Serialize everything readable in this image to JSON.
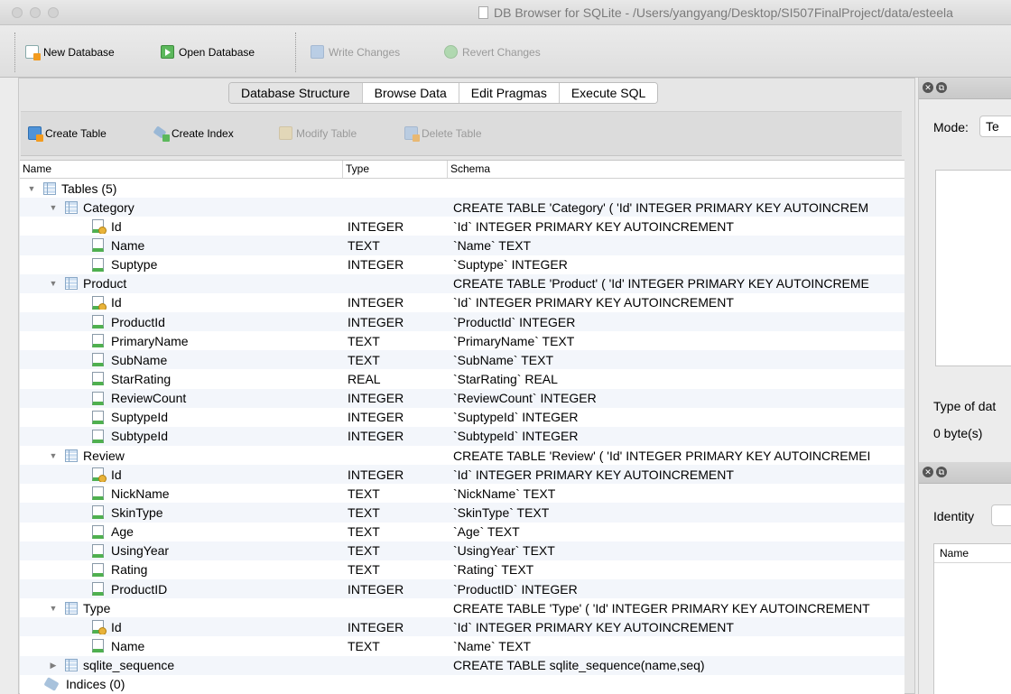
{
  "window": {
    "title": "DB Browser for SQLite - /Users/yangyang/Desktop/SI507FinalProject/data/esteela"
  },
  "toolbar": {
    "new_database": "New Database",
    "open_database": "Open Database",
    "write_changes": "Write Changes",
    "revert_changes": "Revert Changes"
  },
  "tabs": [
    "Database Structure",
    "Browse Data",
    "Edit Pragmas",
    "Execute SQL"
  ],
  "structure_toolbar": {
    "create_table": "Create Table",
    "create_index": "Create Index",
    "modify_table": "Modify Table",
    "delete_table": "Delete Table"
  },
  "tree": {
    "columns": [
      "Name",
      "Type",
      "Schema"
    ],
    "rows": [
      {
        "level": 0,
        "kind": "tables",
        "name": "Tables (5)",
        "type": "",
        "schema": "",
        "expanded": true
      },
      {
        "level": 1,
        "kind": "table",
        "name": "Category",
        "type": "",
        "schema": "CREATE TABLE 'Category' ( 'Id' INTEGER PRIMARY KEY AUTOINCREM",
        "expanded": true
      },
      {
        "level": 2,
        "kind": "key",
        "name": "Id",
        "type": "INTEGER",
        "schema": "`Id` INTEGER PRIMARY KEY AUTOINCREMENT"
      },
      {
        "level": 2,
        "kind": "field",
        "name": "Name",
        "type": "TEXT",
        "schema": "`Name` TEXT"
      },
      {
        "level": 2,
        "kind": "field",
        "name": "Suptype",
        "type": "INTEGER",
        "schema": "`Suptype` INTEGER"
      },
      {
        "level": 1,
        "kind": "table",
        "name": "Product",
        "type": "",
        "schema": "CREATE TABLE 'Product' ( 'Id' INTEGER PRIMARY KEY AUTOINCREME",
        "expanded": true
      },
      {
        "level": 2,
        "kind": "key",
        "name": "Id",
        "type": "INTEGER",
        "schema": "`Id` INTEGER PRIMARY KEY AUTOINCREMENT"
      },
      {
        "level": 2,
        "kind": "field",
        "name": "ProductId",
        "type": "INTEGER",
        "schema": "`ProductId` INTEGER"
      },
      {
        "level": 2,
        "kind": "field",
        "name": "PrimaryName",
        "type": "TEXT",
        "schema": "`PrimaryName` TEXT"
      },
      {
        "level": 2,
        "kind": "field",
        "name": "SubName",
        "type": "TEXT",
        "schema": "`SubName` TEXT"
      },
      {
        "level": 2,
        "kind": "field",
        "name": "StarRating",
        "type": "REAL",
        "schema": "`StarRating` REAL"
      },
      {
        "level": 2,
        "kind": "field",
        "name": "ReviewCount",
        "type": "INTEGER",
        "schema": "`ReviewCount` INTEGER"
      },
      {
        "level": 2,
        "kind": "field",
        "name": "SuptypeId",
        "type": "INTEGER",
        "schema": "`SuptypeId` INTEGER"
      },
      {
        "level": 2,
        "kind": "field",
        "name": "SubtypeId",
        "type": "INTEGER",
        "schema": "`SubtypeId` INTEGER"
      },
      {
        "level": 1,
        "kind": "table",
        "name": "Review",
        "type": "",
        "schema": "CREATE TABLE 'Review' ( 'Id' INTEGER PRIMARY KEY AUTOINCREMEI",
        "expanded": true
      },
      {
        "level": 2,
        "kind": "key",
        "name": "Id",
        "type": "INTEGER",
        "schema": "`Id` INTEGER PRIMARY KEY AUTOINCREMENT"
      },
      {
        "level": 2,
        "kind": "field",
        "name": "NickName",
        "type": "TEXT",
        "schema": "`NickName` TEXT"
      },
      {
        "level": 2,
        "kind": "field",
        "name": "SkinType",
        "type": "TEXT",
        "schema": "`SkinType` TEXT"
      },
      {
        "level": 2,
        "kind": "field",
        "name": "Age",
        "type": "TEXT",
        "schema": "`Age` TEXT"
      },
      {
        "level": 2,
        "kind": "field",
        "name": "UsingYear",
        "type": "TEXT",
        "schema": "`UsingYear` TEXT"
      },
      {
        "level": 2,
        "kind": "field",
        "name": "Rating",
        "type": "TEXT",
        "schema": "`Rating` TEXT"
      },
      {
        "level": 2,
        "kind": "field",
        "name": "ProductID",
        "type": "INTEGER",
        "schema": "`ProductID` INTEGER"
      },
      {
        "level": 1,
        "kind": "table",
        "name": "Type",
        "type": "",
        "schema": "CREATE TABLE 'Type' ( 'Id' INTEGER PRIMARY KEY AUTOINCREMENT",
        "expanded": true
      },
      {
        "level": 2,
        "kind": "key",
        "name": "Id",
        "type": "INTEGER",
        "schema": "`Id` INTEGER PRIMARY KEY AUTOINCREMENT"
      },
      {
        "level": 2,
        "kind": "field",
        "name": "Name",
        "type": "TEXT",
        "schema": "`Name` TEXT"
      },
      {
        "level": 1,
        "kind": "table",
        "name": "sqlite_sequence",
        "type": "",
        "schema": "CREATE TABLE sqlite_sequence(name,seq)",
        "expanded": false
      },
      {
        "level": 0,
        "kind": "indices",
        "name": "Indices (0)",
        "type": "",
        "schema": ""
      }
    ]
  },
  "edit_cell_panel": {
    "mode_label": "Mode:",
    "mode_value": "Te",
    "type_label": "Type of dat",
    "size_label": "0 byte(s)"
  },
  "remote_panel": {
    "identity_label": "Identity",
    "name_column": "Name"
  }
}
